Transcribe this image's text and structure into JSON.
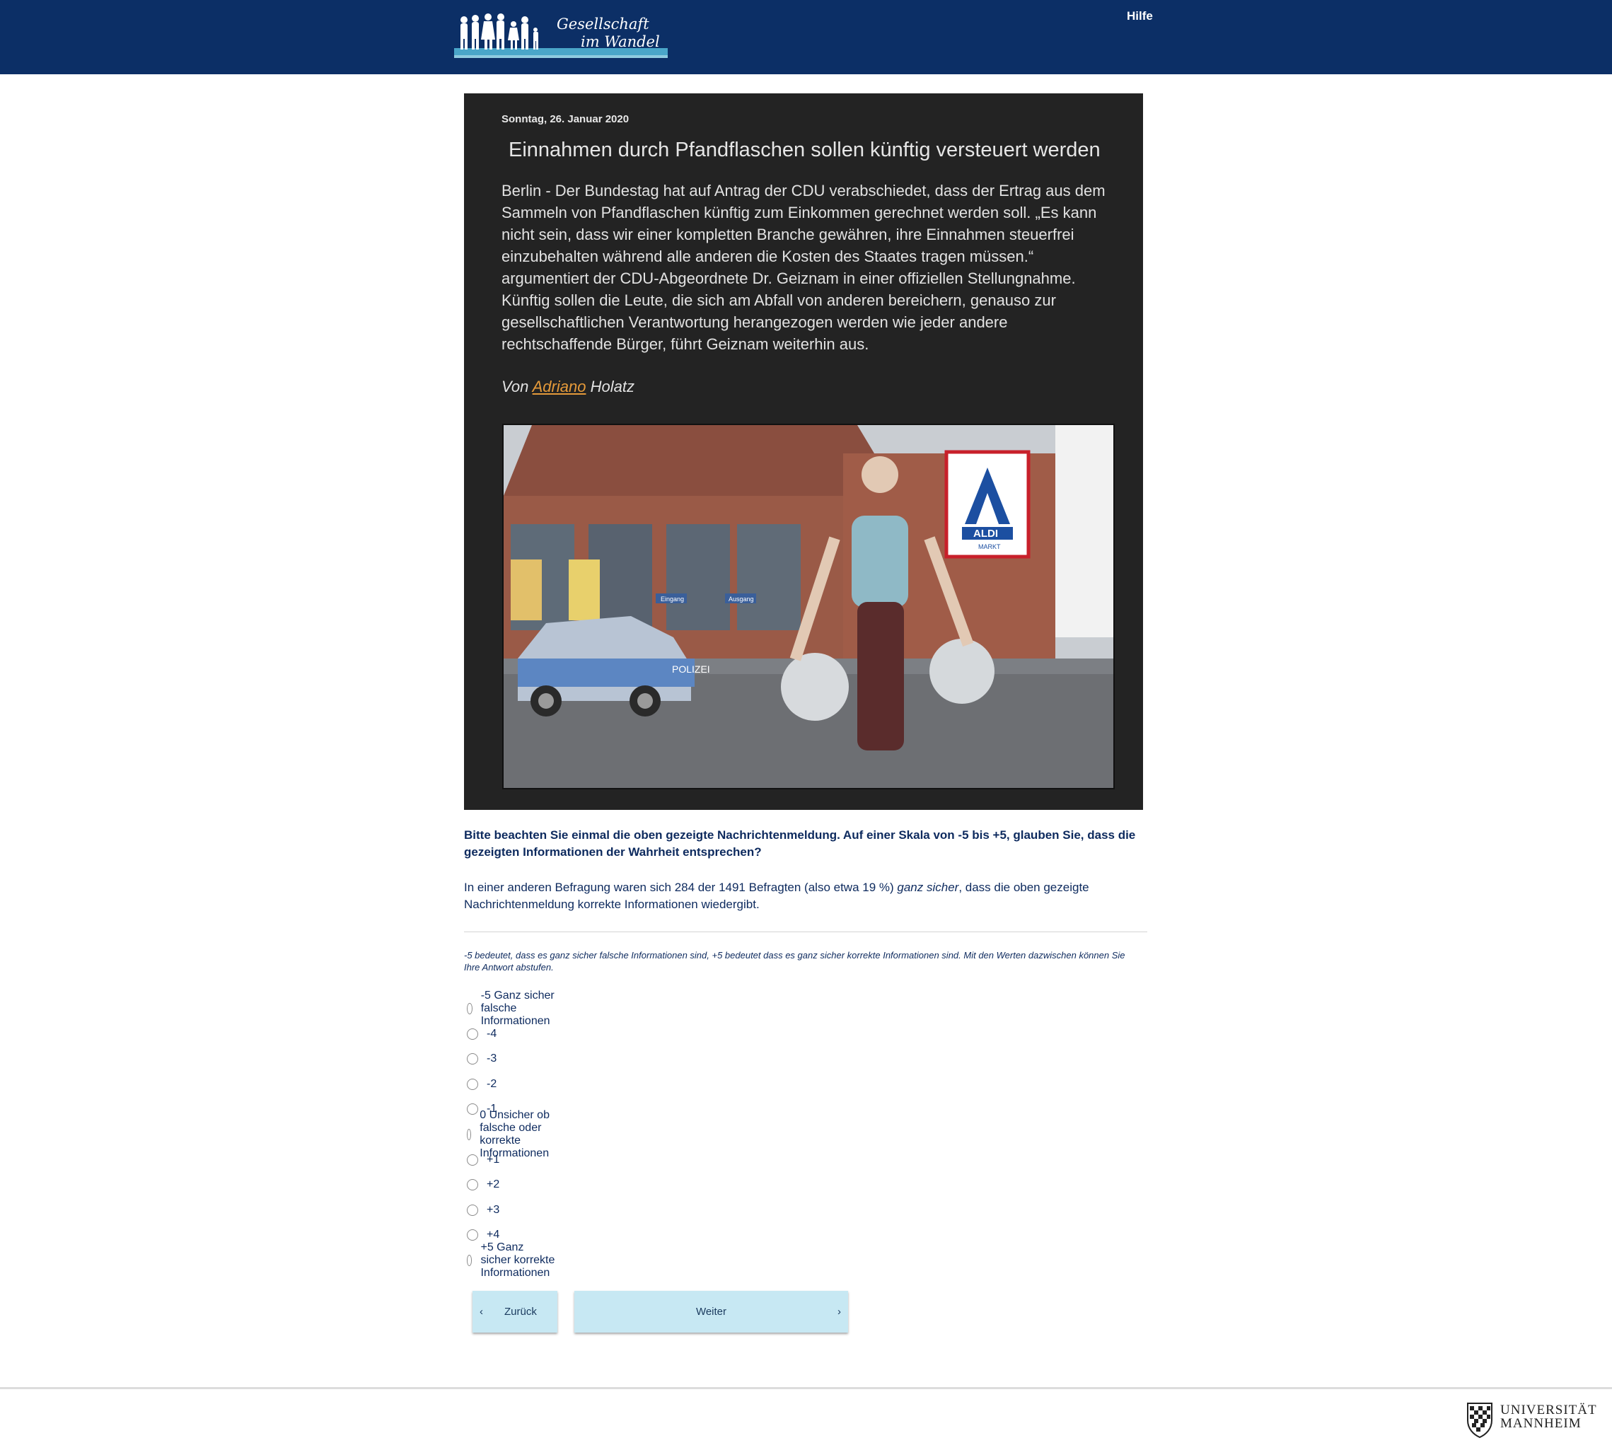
{
  "header": {
    "logo_line1": "Gesellschaft",
    "logo_line2": "im Wandel",
    "help_link": "Hilfe"
  },
  "news": {
    "date": "Sonntag, 26. Januar 2020",
    "title": "Einnahmen durch Pfandflaschen sollen künftig versteuert werden",
    "body": "Berlin - Der Bundestag hat auf Antrag der CDU verabschiedet, dass der Ertrag aus dem Sammeln von Pfandflaschen künftig zum Einkommen gerechnet werden soll. „Es kann nicht sein, dass wir einer kompletten Branche gewähren, ihre Einnahmen steuerfrei einzubehalten während alle anderen die Kosten des Staates tragen müssen.“ argumentiert der CDU-Abgeordnete Dr. Geiznam in einer offiziellen Stellungnahme. Künftig sollen die Leute, die sich am Abfall von anderen bereichern, genauso zur gesellschaftlichen Verantwortung herangezogen werden wie jeder andere rechtschaffende Bürger, führt Geiznam weiterhin aus.",
    "author_prefix": "Von",
    "author_first": "Adriano",
    "author_last": "Holatz",
    "photo_store_sign": "ALDI",
    "photo_store_sub": "MARKT",
    "photo_police": "POLIZEI",
    "photo_entrance": "Eingang",
    "photo_exit": "Ausgang"
  },
  "question": {
    "text": "Bitte beachten Sie einmal die oben gezeigte Nachrichtenmeldung. Auf einer Skala von -5 bis +5, glauben Sie, dass die gezeigten Informationen der Wahrheit entsprechen?",
    "info_before": "In einer anderen Befragung waren sich 284 der 1491 Befragten (also etwa 19 %) ",
    "info_emphasis": "ganz sicher",
    "info_after": ", dass die oben gezeigte Nachrichtenmeldung korrekte Informationen wiedergibt.",
    "note": "-5 bedeutet, dass es ganz sicher falsche Informationen sind, +5 bedeutet dass es ganz sicher korrekte Informationen sind. Mit den Werten dazwischen können Sie Ihre Antwort abstufen."
  },
  "options": [
    "-5 Ganz sicher falsche Informationen",
    "-4",
    "-3",
    "-2",
    "-1",
    "0 Unsicher ob falsche oder korrekte Informationen",
    "+1",
    "+2",
    "+3",
    "+4",
    "+5 Ganz sicher korrekte Informationen"
  ],
  "nav": {
    "back_label": "Zurück",
    "next_label": "Weiter",
    "back_icon": "chevron-left-icon",
    "next_icon": "chevron-right-icon"
  },
  "footer": {
    "uni_line1": "UNIVERSITÄT",
    "uni_line2": "MANNHEIM"
  },
  "colors": {
    "header_bg": "#0c2f66",
    "text_primary": "#0d2a5e",
    "button_bg": "#c7e8f3",
    "news_bg": "#232323",
    "author_link": "#e59a3a"
  }
}
